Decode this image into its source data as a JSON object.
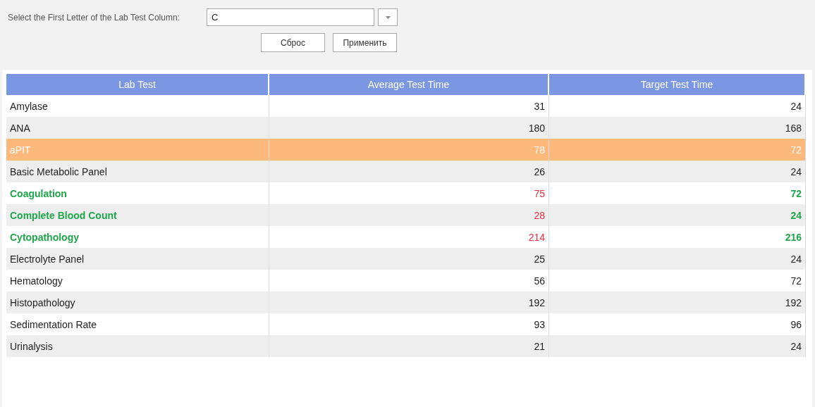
{
  "filter": {
    "label": "Select the First Letter of the Lab Test Column:",
    "value": "C",
    "buttons": [
      "Сброс",
      "Применить"
    ]
  },
  "table": {
    "columns": [
      "Lab Test",
      "Average Test Time",
      "Target Test Time"
    ],
    "rows": [
      {
        "cells": [
          "Amylase",
          "31",
          "24"
        ],
        "selected": false,
        "highlighted": false
      },
      {
        "cells": [
          "ANA",
          "180",
          "168"
        ],
        "selected": false,
        "highlighted": false
      },
      {
        "cells": [
          "aPIT",
          "78",
          "72"
        ],
        "selected": true,
        "highlighted": false
      },
      {
        "cells": [
          "Basic Metabolic Panel",
          "26",
          "24"
        ],
        "selected": false,
        "highlighted": false
      },
      {
        "cells": [
          "Coagulation",
          "75",
          "72"
        ],
        "selected": false,
        "highlighted": true
      },
      {
        "cells": [
          "Complete Blood Count",
          "28",
          "24"
        ],
        "selected": false,
        "highlighted": true
      },
      {
        "cells": [
          "Cytopathology",
          "214",
          "216"
        ],
        "selected": false,
        "highlighted": true
      },
      {
        "cells": [
          "Electrolyte Panel",
          "25",
          "24"
        ],
        "selected": false,
        "highlighted": false
      },
      {
        "cells": [
          "Hematology",
          "56",
          "72"
        ],
        "selected": false,
        "highlighted": false
      },
      {
        "cells": [
          "Histopathology",
          "192",
          "192"
        ],
        "selected": false,
        "highlighted": false
      },
      {
        "cells": [
          "Sedimentation Rate",
          "93",
          "96"
        ],
        "selected": false,
        "highlighted": false
      },
      {
        "cells": [
          "Urinalysis",
          "21",
          "24"
        ],
        "selected": false,
        "highlighted": false
      }
    ]
  }
}
